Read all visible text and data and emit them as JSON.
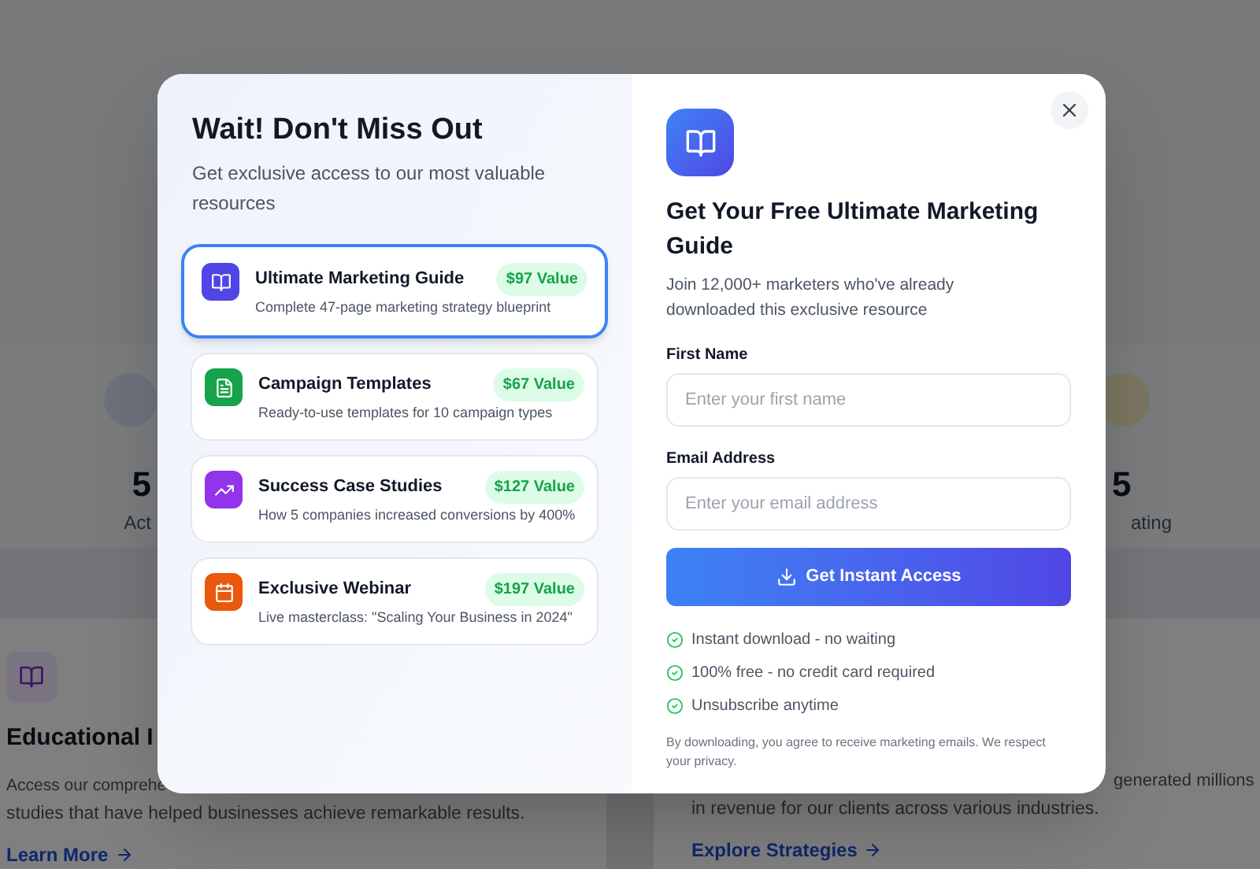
{
  "page": {
    "stats": [
      {
        "value": "5",
        "label": "Act"
      },
      {
        "value": "5",
        "label": "ating"
      }
    ],
    "features": [
      {
        "title": "Educational I",
        "lines": [
          "Access our comprehe",
          "studies that have helped businesses achieve remarkable results."
        ],
        "link": "Learn More"
      },
      {
        "lines": [
          "generated millions",
          "in revenue for our clients across various industries."
        ],
        "link": "Explore Strategies"
      }
    ]
  },
  "modal": {
    "title": "Wait! Don't Miss Out",
    "subtitle": "Get exclusive access to our most valuable resources",
    "resources": [
      {
        "title": "Ultimate Marketing Guide",
        "value": "$97 Value",
        "description": "Complete 47-page marketing strategy blueprint",
        "selected": true,
        "color": "#4f46e5"
      },
      {
        "title": "Campaign Templates",
        "value": "$67 Value",
        "description": "Ready-to-use templates for 10 campaign types",
        "selected": false,
        "color": "#16a34a"
      },
      {
        "title": "Success Case Studies",
        "value": "$127 Value",
        "description": "How 5 companies increased conversions by 400%",
        "selected": false,
        "color": "#9333ea"
      },
      {
        "title": "Exclusive Webinar",
        "value": "$197 Value",
        "description": "Live masterclass: \"Scaling Your Business in 2024\"",
        "selected": false,
        "color": "#ea580c"
      }
    ],
    "form": {
      "heading": "Get Your Free Ultimate Marketing Guide",
      "subheading": "Join 12,000+ marketers who've already downloaded this exclusive resource",
      "fields": [
        {
          "label": "First Name",
          "placeholder": "Enter your first name"
        },
        {
          "label": "Email Address",
          "placeholder": "Enter your email address"
        }
      ],
      "button": "Get Instant Access",
      "benefits": [
        "Instant download - no waiting",
        "100% free - no credit card required",
        "Unsubscribe anytime"
      ],
      "disclaimer": "By downloading, you agree to receive marketing emails. We respect your privacy."
    }
  }
}
